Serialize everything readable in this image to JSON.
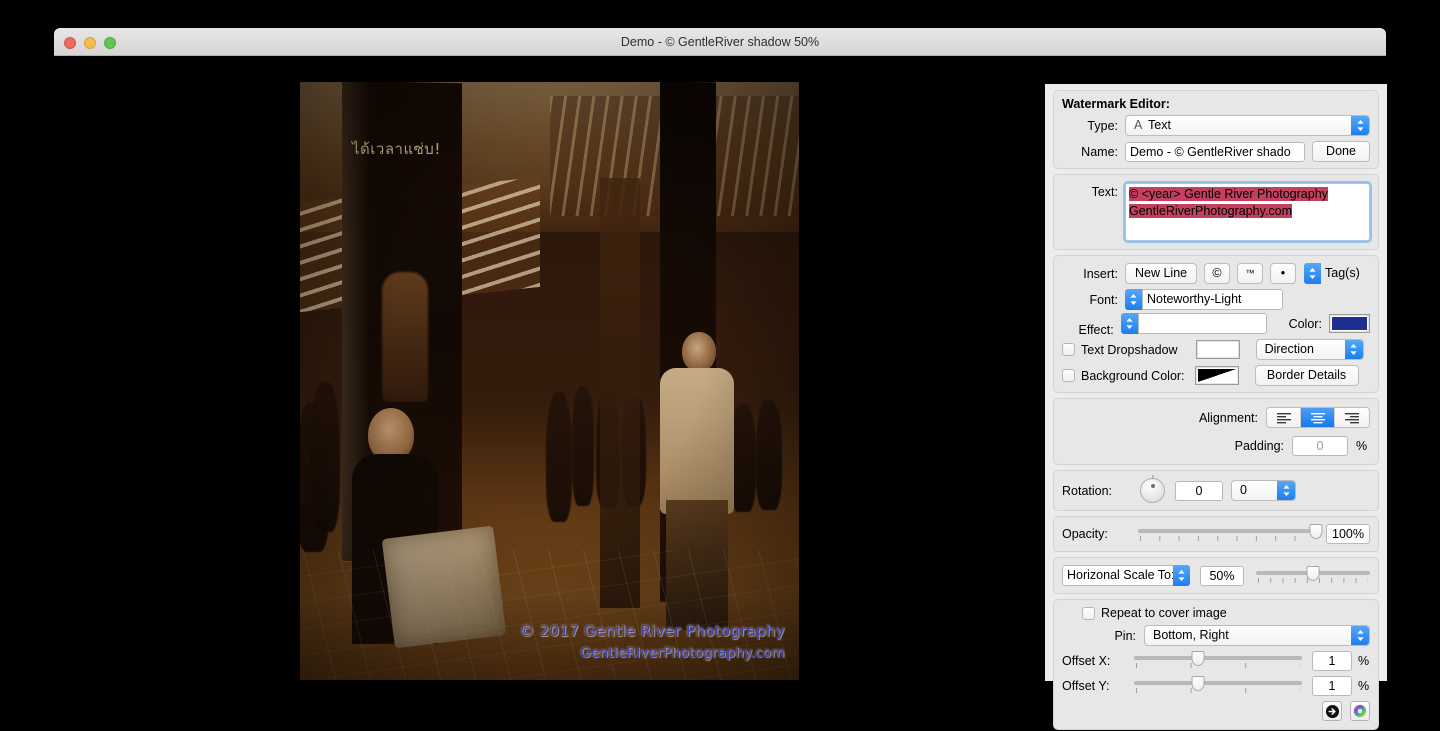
{
  "window": {
    "title": "Demo -  © GentleRiver shadow 50%",
    "traffic": {
      "close": "close-button",
      "minimize": "minimize-button",
      "maximize": "maximize-button"
    }
  },
  "photo": {
    "ad_headline": "ได้เวลาแซ่บ!",
    "watermark_line1": "© 2017 Gentle River Photography",
    "watermark_line2": "GentleRiverPhotography.com",
    "watermark_color": "#3a3fb0"
  },
  "inspector": {
    "heading": "Watermark Editor:",
    "type": {
      "label": "Type:",
      "value": "Text",
      "icon_glyph": "A"
    },
    "name": {
      "label": "Name:",
      "value": "Demo -  © GentleRiver shado",
      "done_label": "Done"
    },
    "text": {
      "label": "Text:",
      "line1": "© <year> Gentle River Photography",
      "line2": "GentleRiverPhotography.com",
      "selection_color": "#c4405f"
    },
    "insert": {
      "label": "Insert:",
      "new_line": "New Line",
      "copyright": "©",
      "trademark": "™",
      "bullet": "•",
      "tags": "Tag(s)"
    },
    "font": {
      "label": "Font:",
      "value": "Noteworthy-Light"
    },
    "effect": {
      "label": "Effect:",
      "value": ""
    },
    "color": {
      "label": "Color:",
      "value": "#1f2f8f"
    },
    "dropshadow": {
      "label": "Text Dropshadow",
      "checked": false,
      "swatch": "#ffffff",
      "direction_label": "Direction"
    },
    "background": {
      "label": "Background Color:",
      "checked": false,
      "swatch": "#000000",
      "border_details_label": "Border Details"
    },
    "alignment": {
      "label": "Alignment:",
      "options": [
        "left",
        "center",
        "right"
      ],
      "selected": "center"
    },
    "padding": {
      "label": "Padding:",
      "value": "0",
      "unit": "%"
    },
    "rotation": {
      "label": "Rotation:",
      "value": "0",
      "stepper_value": "0"
    },
    "opacity": {
      "label": "Opacity:",
      "value": "100%",
      "percent": 100
    },
    "scale": {
      "label": "Horizonal Scale To:",
      "value": "50%",
      "percent": 50
    },
    "repeat": {
      "label": "Repeat to cover image",
      "checked": false
    },
    "pin": {
      "label": "Pin:",
      "value": "Bottom, Right"
    },
    "offset_x": {
      "label": "Offset X:",
      "value": "1",
      "unit": "%",
      "percent": 38
    },
    "offset_y": {
      "label": "Offset Y:",
      "value": "1",
      "unit": "%",
      "percent": 38
    },
    "footer": {
      "apply_icon": "arrow-right-circle-icon",
      "colorwheel_icon": "color-wheel-icon"
    }
  }
}
